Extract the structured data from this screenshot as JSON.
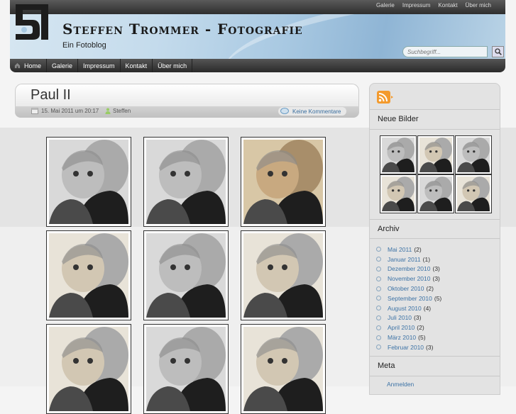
{
  "top_nav": [
    "Galerie",
    "Impressum",
    "Kontakt",
    "Über mich"
  ],
  "site": {
    "title": "Steffen Trommer - Fotografie",
    "subtitle": "Ein Fotoblog"
  },
  "search": {
    "placeholder": "Suchbegriff..."
  },
  "main_nav": [
    "Home",
    "Galerie",
    "Impressum",
    "Kontakt",
    "Über mich"
  ],
  "post": {
    "title": "Paul II",
    "date": "15. Mai 2011 um 20:17",
    "author": "Steffen",
    "comments": "Keine Kommentare"
  },
  "gallery_count": 9,
  "sidebar": {
    "new_images_heading": "Neue Bilder",
    "archive_heading": "Archiv",
    "archive": [
      {
        "label": "Mai 2011",
        "count": "(2)"
      },
      {
        "label": "Januar 2011",
        "count": "(1)"
      },
      {
        "label": "Dezember 2010",
        "count": "(3)"
      },
      {
        "label": "November 2010",
        "count": "(3)"
      },
      {
        "label": "Oktober 2010",
        "count": "(2)"
      },
      {
        "label": "September 2010",
        "count": "(5)"
      },
      {
        "label": "August 2010",
        "count": "(4)"
      },
      {
        "label": "Juli 2010",
        "count": "(3)"
      },
      {
        "label": "April 2010",
        "count": "(2)"
      },
      {
        "label": "März 2010",
        "count": "(5)"
      },
      {
        "label": "Februar 2010",
        "count": "(3)"
      }
    ],
    "meta_heading": "Meta",
    "meta_links": [
      "Anmelden"
    ]
  },
  "colors": {
    "link": "#3d73a6",
    "nav_dark": "#2a2a2a",
    "header_blue": "#a9c9e2"
  },
  "icons": [
    "rss-icon",
    "home-icon",
    "calendar-icon",
    "user-icon",
    "comment-icon",
    "search-icon"
  ]
}
